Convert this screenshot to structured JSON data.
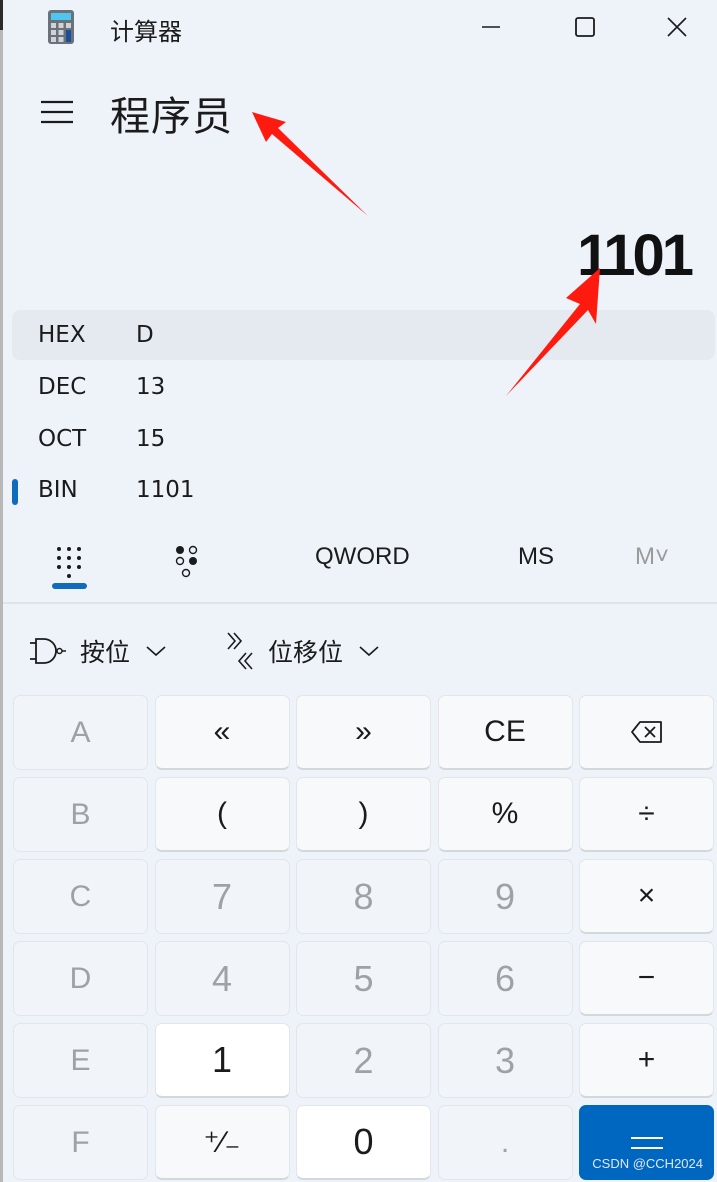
{
  "window": {
    "title": "计算器",
    "icon": "calculator-icon",
    "controls": [
      "minimize-icon",
      "maximize-icon",
      "close-icon"
    ]
  },
  "header": {
    "menu_icon": "hamburger-icon",
    "mode_title": "程序员"
  },
  "display": {
    "value": "1101"
  },
  "radix": [
    {
      "label": "HEX",
      "value": "D",
      "selected": true
    },
    {
      "label": "DEC",
      "value": "13"
    },
    {
      "label": "OCT",
      "value": "15"
    },
    {
      "label": "BIN",
      "value": "1101",
      "active": true
    }
  ],
  "toolbar": {
    "keypad_tab_icon": "full-keypad-icon",
    "bitflip_tab_icon": "bit-toggling-keypad-icon",
    "word_size": "QWORD",
    "memory_store": "MS",
    "memory_list": "M˅"
  },
  "operators": {
    "bitwise": {
      "label": "按位",
      "icon": "logic-gate-icon"
    },
    "bitshift": {
      "label": "位移位",
      "icon": "bit-shift-icon"
    }
  },
  "keypad": [
    [
      {
        "label": "A",
        "state": "off"
      },
      {
        "label": "«",
        "state": "on"
      },
      {
        "label": "»",
        "state": "on"
      },
      {
        "label": "CE",
        "state": "on"
      },
      {
        "label": "⌫",
        "state": "on",
        "icon": "backspace-icon"
      }
    ],
    [
      {
        "label": "B",
        "state": "off"
      },
      {
        "label": "(",
        "state": "on"
      },
      {
        "label": ")",
        "state": "on"
      },
      {
        "label": "%",
        "state": "on"
      },
      {
        "label": "÷",
        "state": "on"
      }
    ],
    [
      {
        "label": "C",
        "state": "off"
      },
      {
        "label": "7",
        "state": "off"
      },
      {
        "label": "8",
        "state": "off"
      },
      {
        "label": "9",
        "state": "off"
      },
      {
        "label": "×",
        "state": "on"
      }
    ],
    [
      {
        "label": "D",
        "state": "off"
      },
      {
        "label": "4",
        "state": "off"
      },
      {
        "label": "5",
        "state": "off"
      },
      {
        "label": "6",
        "state": "off"
      },
      {
        "label": "−",
        "state": "on"
      }
    ],
    [
      {
        "label": "E",
        "state": "off"
      },
      {
        "label": "1",
        "state": "on"
      },
      {
        "label": "2",
        "state": "off"
      },
      {
        "label": "3",
        "state": "off"
      },
      {
        "label": "+",
        "state": "on"
      }
    ],
    [
      {
        "label": "F",
        "state": "off"
      },
      {
        "label": "⁺∕₋",
        "state": "on"
      },
      {
        "label": "0",
        "state": "on"
      },
      {
        "label": ".",
        "state": "off"
      },
      {
        "label": "=",
        "state": "primary"
      }
    ]
  ],
  "watermark": "CSDN @CCH2024",
  "colors": {
    "accent": "#0067c0",
    "annotation_arrow": "#ff1a10",
    "background": "#eef3fa"
  }
}
